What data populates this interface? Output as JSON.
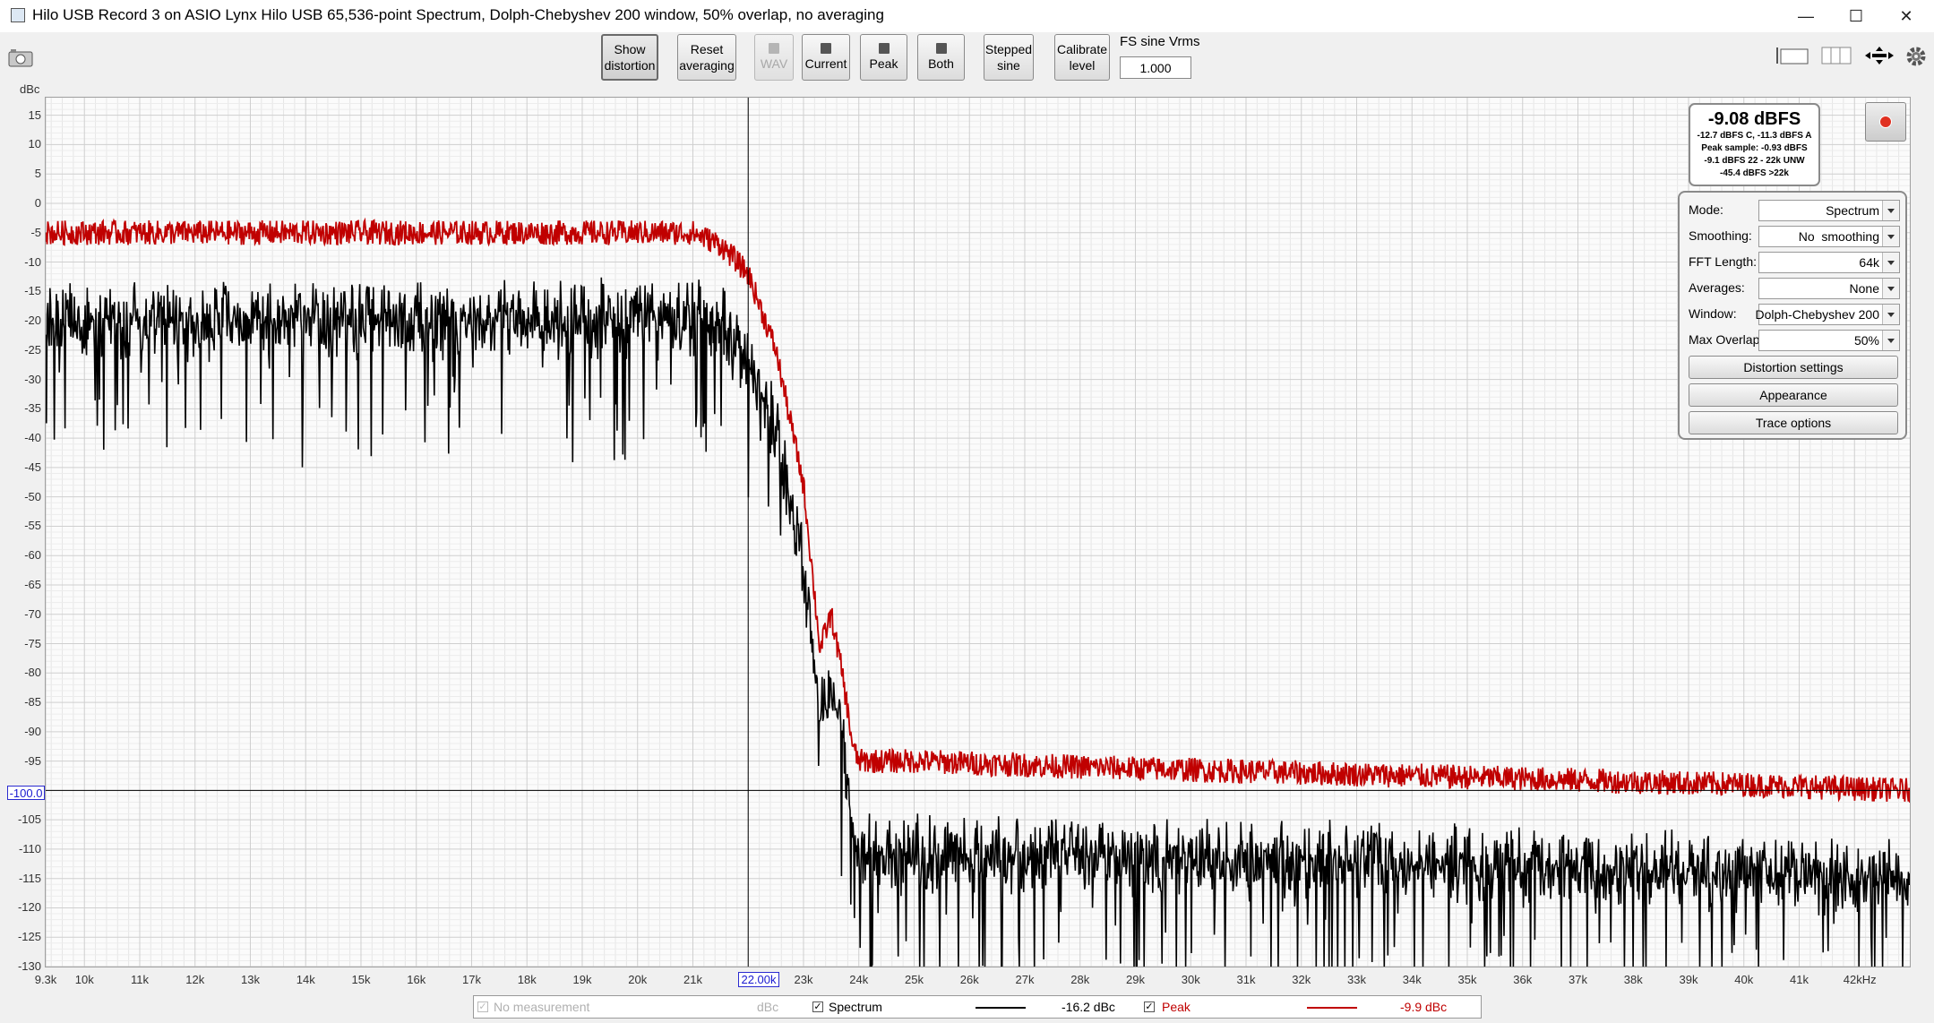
{
  "window": {
    "title": "Hilo USB Record 3 on ASIO Lynx Hilo USB 65,536-point Spectrum, Dolph-Chebyshev 200 window, 50% overlap, no averaging",
    "minimize": "—",
    "maximize": "☐",
    "close": "✕"
  },
  "toolbar": {
    "buttons": [
      {
        "line1": "Show",
        "line2": "distortion"
      },
      {
        "line1": "Reset",
        "line2": "averaging"
      },
      {
        "line1": "WAV",
        "line2": ""
      },
      {
        "line1": "Current",
        "line2": ""
      },
      {
        "line1": "Peak",
        "line2": ""
      },
      {
        "line1": "Both",
        "line2": ""
      },
      {
        "line1": "Stepped",
        "line2": "sine"
      },
      {
        "line1": "Calibrate",
        "line2": "level"
      }
    ],
    "fs_label": "FS sine Vrms",
    "fs_value": "1.000"
  },
  "level_meter": {
    "main": "-9.08 dBFS",
    "line1": "-12.7 dBFS C, -11.3 dBFS A",
    "line2": "Peak sample: -0.93 dBFS",
    "line3": "-9.1 dBFS 22 - 22k UNW",
    "line4": "-45.4 dBFS >22k"
  },
  "controls": {
    "rows": [
      {
        "label": "Mode:",
        "value": "Spectrum"
      },
      {
        "label": "Smoothing:",
        "value": "No  smoothing"
      },
      {
        "label": "FFT Length:",
        "value": "64k"
      },
      {
        "label": "Averages:",
        "value": "None"
      },
      {
        "label": "Window:",
        "value": "Dolph-Chebyshev 200"
      },
      {
        "label": "Max Overlap:",
        "value": "50%"
      }
    ],
    "buttons": [
      "Distortion settings",
      "Appearance",
      "Trace options"
    ]
  },
  "legend": {
    "no_measurement": "No measurement",
    "no_measurement_unit": "dBc",
    "spectrum_label": "Spectrum",
    "spectrum_value": "-16.2 dBc",
    "peak_label": "Peak",
    "peak_value": "-9.9 dBc"
  },
  "cursor": {
    "x_label": "22.00k",
    "y_label": "-100.0"
  },
  "colors": {
    "spectrum": "#000000",
    "peak": "#c00000",
    "cursor": "#1a1ad0",
    "grid": "#d8d8d8"
  },
  "chart_data": {
    "type": "line",
    "xlabel": "",
    "ylabel": "dBc",
    "xlim": [
      9300,
      43000
    ],
    "ylim": [
      -130,
      18
    ],
    "x_ticks": [
      9300,
      10000,
      11000,
      12000,
      13000,
      14000,
      15000,
      16000,
      17000,
      18000,
      19000,
      20000,
      21000,
      22000,
      23000,
      24000,
      25000,
      26000,
      27000,
      28000,
      29000,
      30000,
      31000,
      32000,
      33000,
      34000,
      35000,
      36000,
      37000,
      38000,
      39000,
      40000,
      41000,
      42000
    ],
    "x_tick_labels": [
      "9.3k",
      "10k",
      "11k",
      "12k",
      "13k",
      "14k",
      "15k",
      "16k",
      "17k",
      "18k",
      "19k",
      "20k",
      "21k",
      "",
      "23k",
      "24k",
      "25k",
      "26k",
      "27k",
      "28k",
      "29k",
      "30k",
      "31k",
      "32k",
      "33k",
      "34k",
      "35k",
      "36k",
      "37k",
      "38k",
      "39k",
      "40k",
      "41k",
      "42kHz"
    ],
    "y_ticks": [
      15,
      10,
      5,
      0,
      -5,
      -10,
      -15,
      -20,
      -25,
      -30,
      -35,
      -40,
      -45,
      -50,
      -55,
      -60,
      -65,
      -70,
      -75,
      -80,
      -85,
      -90,
      -95,
      -100,
      -105,
      -110,
      -115,
      -120,
      -125,
      -130
    ],
    "y_tick_labels": [
      "15",
      "10",
      "5",
      "0",
      "-5",
      "-10",
      "-15",
      "-20",
      "-25",
      "-30",
      "-35",
      "-40",
      "-45",
      "-50",
      "-55",
      "-60",
      "-65",
      "-70",
      "-75",
      "-80",
      "-85",
      "-90",
      "-95",
      "",
      "-105",
      "-110",
      "-115",
      "-120",
      "-125",
      "-130"
    ],
    "grid": true,
    "series": [
      {
        "name": "Spectrum",
        "color": "#000000",
        "x": [
          9300,
          12000,
          16000,
          20000,
          21000,
          21500,
          22000,
          22500,
          23000,
          23300,
          23500,
          23700,
          23900,
          24000,
          25000,
          28000,
          32000,
          36000,
          40000,
          43000
        ],
        "y": [
          -17,
          -17,
          -17,
          -17,
          -17,
          -18,
          -24,
          -36,
          -58,
          -85,
          -78,
          -88,
          -102,
          -108,
          -108,
          -108,
          -109,
          -110,
          -111,
          -112
        ],
        "noise_dB": 12
      },
      {
        "name": "Peak",
        "color": "#c00000",
        "x": [
          9300,
          12000,
          16000,
          20000,
          21000,
          21500,
          22000,
          22500,
          23000,
          23300,
          23500,
          23700,
          23900,
          24000,
          25000,
          28000,
          32000,
          36000,
          40000,
          43000
        ],
        "y": [
          -5,
          -5,
          -5,
          -5,
          -5,
          -7,
          -12,
          -25,
          -48,
          -76,
          -70,
          -80,
          -93,
          -95,
          -95,
          -96,
          -97,
          -98,
          -99,
          -100
        ],
        "noise_dB": 3
      }
    ]
  }
}
